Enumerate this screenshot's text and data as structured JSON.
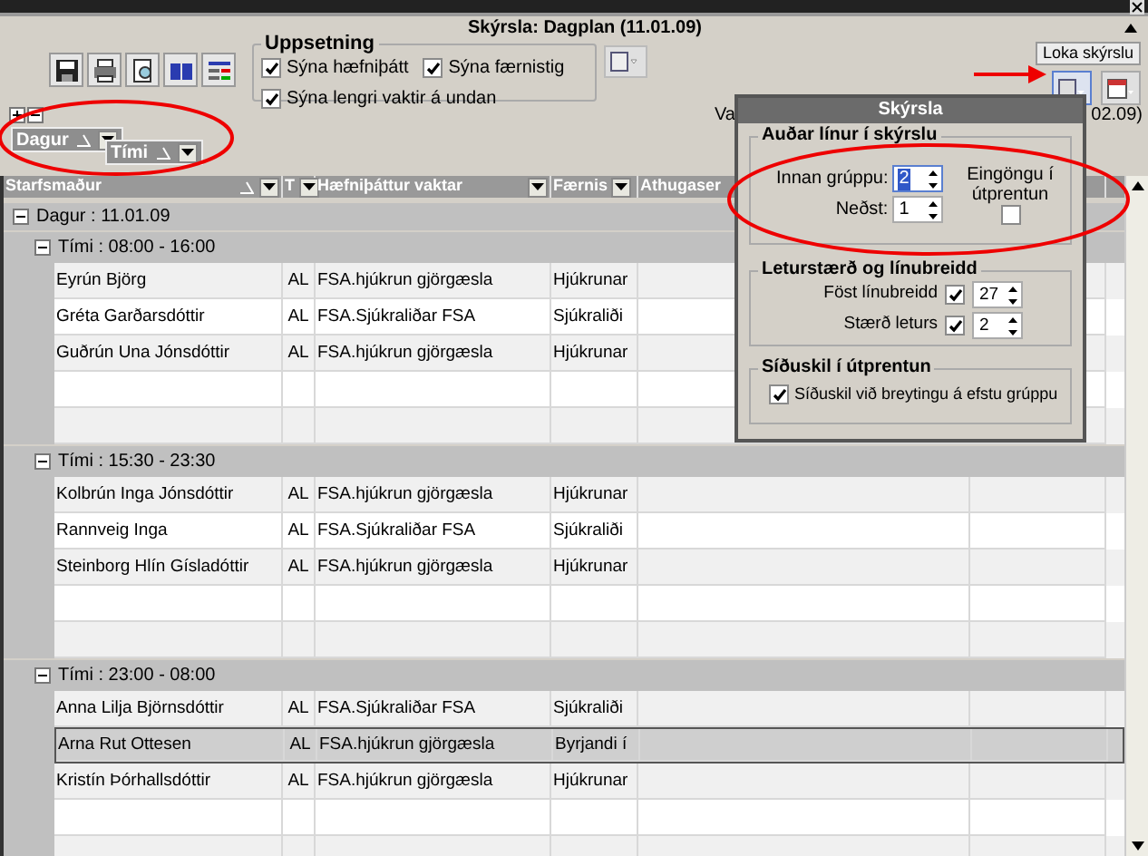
{
  "window": {
    "title": "Skýrsla: Dagplan (11.01.09)"
  },
  "setup": {
    "title": "Uppsetning",
    "options": [
      {
        "label": "Sýna hæfniþátt",
        "checked": true
      },
      {
        "label": "Sýna færnistig",
        "checked": true
      },
      {
        "label": "Sýna lengri vaktir á undan",
        "checked": true
      }
    ]
  },
  "close_button": "Loka skýrslu",
  "date_range": {
    "start": "Va",
    "end": "02.09)"
  },
  "group_by": [
    {
      "label": "Dagur"
    },
    {
      "label": "Tími"
    }
  ],
  "columns": [
    "Starfsmaður",
    "T",
    "Hæfniþáttur vaktar",
    "Færnis",
    "Athugaser"
  ],
  "groups": [
    {
      "label": "Dagur : 11.01.09",
      "expanded": true,
      "children": [
        {
          "label": "Tími : 08:00 - 16:00",
          "expanded": true,
          "rows": [
            {
              "kind": "data",
              "selected": false,
              "cells": [
                "Eyrún Björg",
                "AL",
                "FSA.hjúkrun gjörgæsla",
                "Hjúkrunar"
              ]
            },
            {
              "kind": "data",
              "selected": false,
              "cells": [
                "Gréta Garðarsdóttir",
                "AL",
                "FSA.Sjúkraliðar FSA",
                "Sjúkraliði"
              ]
            },
            {
              "kind": "data",
              "selected": false,
              "cells": [
                "Guðrún Una Jónsdóttir",
                "AL",
                "FSA.hjúkrun gjörgæsla",
                "Hjúkrunar"
              ]
            },
            {
              "kind": "blank",
              "selected": false
            },
            {
              "kind": "blank",
              "selected": false
            }
          ]
        },
        {
          "label": "Tími : 15:30 - 23:30",
          "expanded": true,
          "rows": [
            {
              "kind": "data",
              "selected": false,
              "cells": [
                "Kolbrún Inga Jónsdóttir",
                "AL",
                "FSA.hjúkrun gjörgæsla",
                "Hjúkrunar"
              ]
            },
            {
              "kind": "data",
              "selected": false,
              "cells": [
                "Rannveig Inga",
                "AL",
                "FSA.Sjúkraliðar FSA",
                "Sjúkraliði"
              ]
            },
            {
              "kind": "data",
              "selected": false,
              "cells": [
                "Steinborg Hlín Gísladóttir",
                "AL",
                "FSA.hjúkrun gjörgæsla",
                "Hjúkrunar"
              ]
            },
            {
              "kind": "blank",
              "selected": false
            },
            {
              "kind": "blank",
              "selected": false
            }
          ]
        },
        {
          "label": "Tími : 23:00 - 08:00",
          "expanded": true,
          "rows": [
            {
              "kind": "data",
              "selected": false,
              "cells": [
                "Anna Lilja Björnsdóttir",
                "AL",
                "FSA.Sjúkraliðar FSA",
                "Sjúkraliði"
              ]
            },
            {
              "kind": "data",
              "selected": true,
              "cells": [
                "Arna Rut Ottesen",
                "AL",
                "FSA.hjúkrun gjörgæsla",
                "Byrjandi í"
              ]
            },
            {
              "kind": "data",
              "selected": false,
              "cells": [
                "Kristín Þórhallsdóttir",
                "AL",
                "FSA.hjúkrun gjörgæsla",
                "Hjúkrunar"
              ]
            },
            {
              "kind": "blank",
              "selected": false
            },
            {
              "kind": "blank",
              "selected": false
            }
          ]
        }
      ]
    }
  ],
  "popup": {
    "title": "Skýrsla",
    "blank_lines": {
      "title": "Auðar línur í skýrslu",
      "within_group": {
        "label": "Innan grúppu:",
        "value": "2"
      },
      "bottom": {
        "label": "Neðst:",
        "value": "1"
      },
      "print_only": {
        "label": "Eingöngu í útprentun",
        "checked": false
      }
    },
    "font": {
      "title": "Leturstærð og línubreidd",
      "fields": [
        {
          "label": "Föst línubreidd",
          "checked": true,
          "value": "27"
        },
        {
          "label": "Stærð leturs",
          "checked": true,
          "value": "2"
        }
      ]
    },
    "page_breaks": {
      "title": "Síðuskil í útprentun",
      "option": {
        "label": "Síðuskil við breytingu á efstu grúppu",
        "checked": true
      }
    }
  }
}
